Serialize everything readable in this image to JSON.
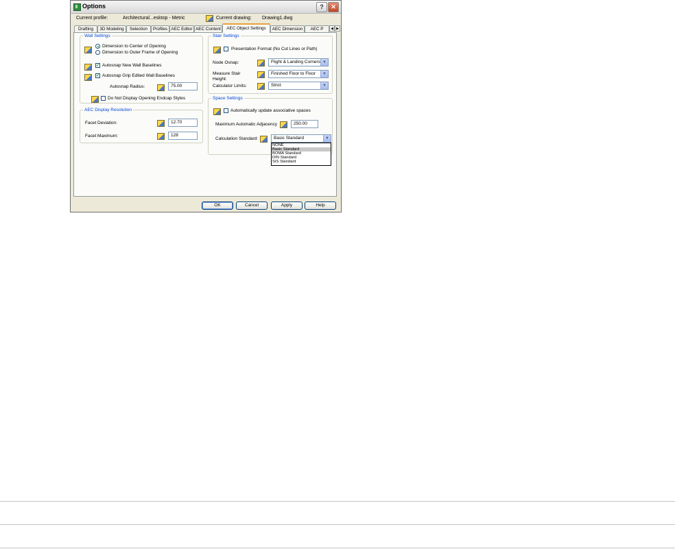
{
  "window": {
    "title": "Options"
  },
  "header": {
    "profile_label": "Current profile:",
    "profile_value": "Architectural...esktop - Metric",
    "drawing_label": "Current drawing:",
    "drawing_value": "Drawing1.dwg"
  },
  "tabs": [
    {
      "label": "Drafting"
    },
    {
      "label": "3D Modeling"
    },
    {
      "label": "Selection"
    },
    {
      "label": "Profiles"
    },
    {
      "label": "AEC Editor"
    },
    {
      "label": "AEC Content"
    },
    {
      "label": "AEC Object Settings",
      "active": true
    },
    {
      "label": "AEC Dimension"
    },
    {
      "label": "AEC P"
    }
  ],
  "wall_settings": {
    "legend": "Wall Settings",
    "radio_center": {
      "label": "Dimension to Center of Opening",
      "selected": true
    },
    "radio_outer": {
      "label": "Dimension to Outer Frame of Opening",
      "selected": false
    },
    "autosnap_new": {
      "label": "Autosnap New Wall Baselines",
      "checked": true
    },
    "autosnap_grip": {
      "label": "Autosnap Grip Edited Wall Baselines",
      "checked": true
    },
    "radius_label": "Autosnap Radius:",
    "radius_value": "75.00",
    "endcap": {
      "label": "Do Not Display Opening Endcap Styles",
      "checked": false
    }
  },
  "display_resolution": {
    "legend": "AEC Display Resolution",
    "deviation_label": "Facet Deviation:",
    "deviation_value": "12.70",
    "maximum_label": "Facet Maximum:",
    "maximum_value": "128"
  },
  "stair_settings": {
    "legend": "Stair Settings",
    "presentation": {
      "label": "Presentation Format (No Cut Lines or Path)",
      "checked": false
    },
    "node_osnap_label": "Node Osnap:",
    "node_osnap_value": "Flight & Landing Corners",
    "measure_label_1": "Measure Stair",
    "measure_label_2": "Height:",
    "measure_value": "Finished Floor to Floor",
    "calc_limits_label": "Calculator Limits:",
    "calc_limits_value": "Strict"
  },
  "space_settings": {
    "legend": "Space Settings",
    "auto_update": {
      "label": "Automatically update associative spaces",
      "checked": false
    },
    "adjacency_label": "Maximum Automatic Adjacency",
    "adjacency_value": "250.00",
    "calc_standard_label": "Calculation Standard:",
    "calc_standard_value": "Basic Standard",
    "calc_standard_options": [
      "NONE",
      "Basic Standard",
      "BOMA Standard",
      "DIN Standard",
      "SIS Standard"
    ]
  },
  "buttons": {
    "ok": "OK",
    "cancel": "Cancel",
    "apply": "Apply",
    "help": "Help"
  },
  "colors": {
    "accent": "#0046d5",
    "tab_highlight": "#e6a23c",
    "dialog_bg": "#ece9d8"
  }
}
